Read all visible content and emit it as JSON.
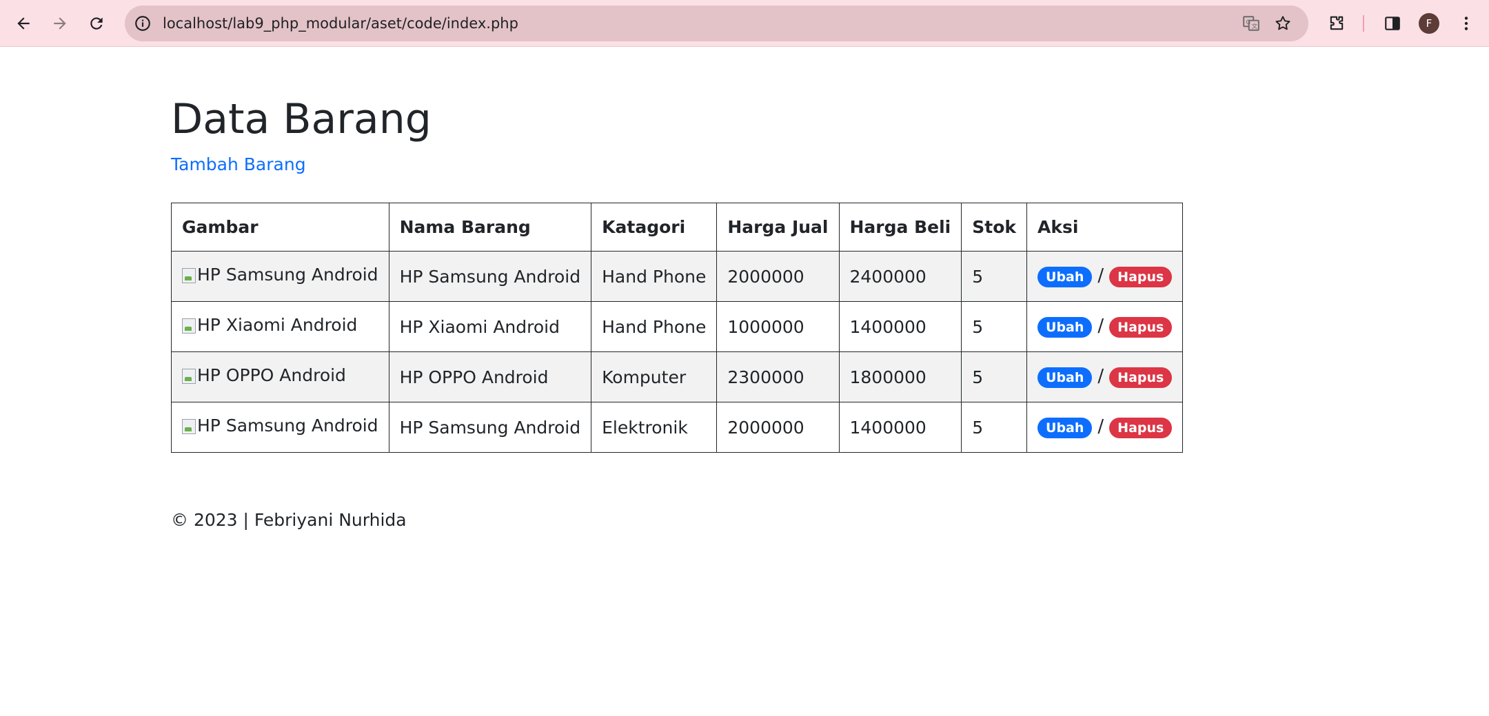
{
  "browser": {
    "url": "localhost/lab9_php_modular/aset/code/index.php",
    "profile_initial": "F"
  },
  "page": {
    "title": "Data Barang",
    "add_link": "Tambah Barang"
  },
  "table": {
    "headers": [
      "Gambar",
      "Nama Barang",
      "Katagori",
      "Harga Jual",
      "Harga Beli",
      "Stok",
      "Aksi"
    ],
    "rows": [
      {
        "gambar_alt": "HP Samsung Android",
        "nama": "HP Samsung Android",
        "kategori": "Hand Phone",
        "harga_jual": "2000000",
        "harga_beli": "2400000",
        "stok": "5"
      },
      {
        "gambar_alt": "HP Xiaomi Android",
        "nama": "HP Xiaomi Android",
        "kategori": "Hand Phone",
        "harga_jual": "1000000",
        "harga_beli": "1400000",
        "stok": "5"
      },
      {
        "gambar_alt": "HP OPPO Android",
        "nama": "HP OPPO Android",
        "kategori": "Komputer",
        "harga_jual": "2300000",
        "harga_beli": "1800000",
        "stok": "5"
      },
      {
        "gambar_alt": "HP Samsung Android",
        "nama": "HP Samsung Android",
        "kategori": "Elektronik",
        "harga_jual": "2000000",
        "harga_beli": "1400000",
        "stok": "5"
      }
    ],
    "actions": {
      "edit_label": "Ubah",
      "separator": "/",
      "delete_label": "Hapus"
    }
  },
  "footer": {
    "text": "© 2023 | Febriyani Nurhida"
  },
  "colors": {
    "link": "#0d6efd",
    "edit_badge": "#0d6efd",
    "delete_badge": "#dc3545",
    "chrome": "#fbe0e6"
  }
}
